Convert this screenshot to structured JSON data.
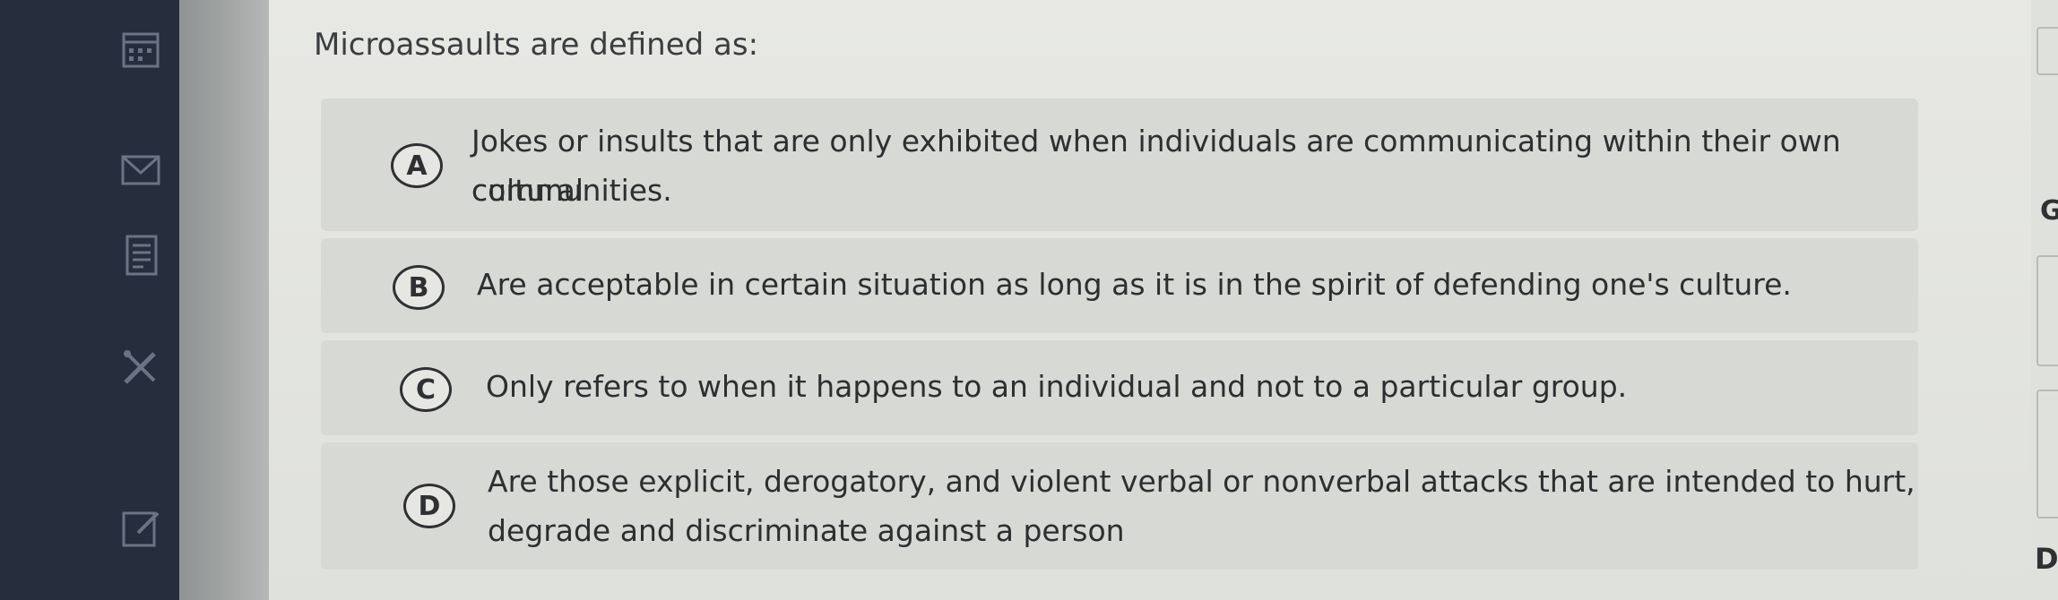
{
  "question": "Microassaults are defined as:",
  "options": [
    {
      "letter": "A",
      "line1": "Jokes or insults that are only exhibited when individuals are communicating within their own cultural",
      "line2": "communities."
    },
    {
      "letter": "B",
      "line1": "Are acceptable in certain situation as long as it is in the spirit of defending one's culture."
    },
    {
      "letter": "C",
      "line1": "Only refers to when it happens to an individual and not to a particular group."
    },
    {
      "letter": "D",
      "line1": "Are those explicit, derogatory, and violent verbal or nonverbal attacks that are intended to hurt,",
      "line2": "degrade and discriminate against a person"
    }
  ],
  "right_panel": {
    "top_letter": "G",
    "bottom_text": "De"
  },
  "sidebar_icons": [
    "calendar-icon",
    "mail-icon",
    "document-icon",
    "tools-icon",
    "edit-icon"
  ]
}
